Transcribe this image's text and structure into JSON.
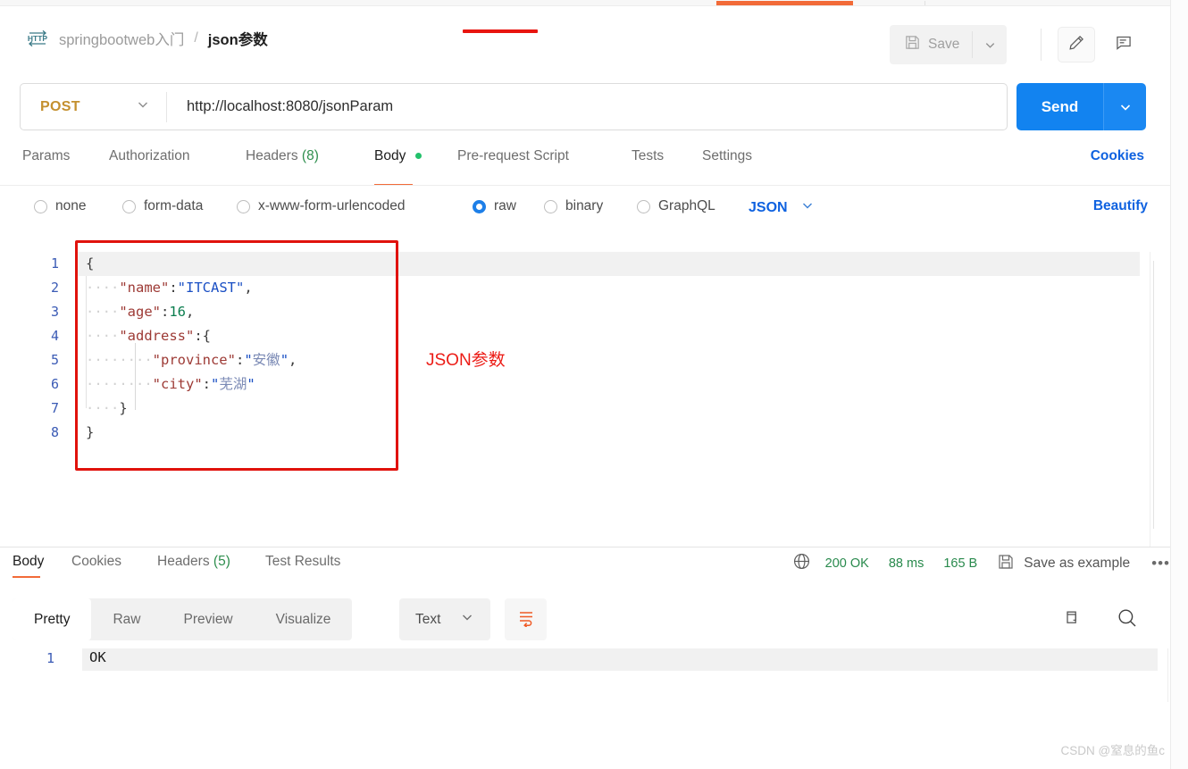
{
  "header": {
    "protocol_icon": "http-icon",
    "breadcrumb_parent": "springbootweb入门",
    "breadcrumb_separator": "/",
    "breadcrumb_current": "json参数",
    "save_label": "Save",
    "save_icon": "floppy-disk-icon",
    "save_caret_icon": "chevron-down-icon",
    "edit_icon": "pencil-icon",
    "comment_icon": "comment-icon"
  },
  "request": {
    "method": "POST",
    "method_caret_icon": "chevron-down-icon",
    "url": "http://localhost:8080/jsonParam",
    "send_label": "Send",
    "send_caret_icon": "chevron-down-icon",
    "tabs": [
      {
        "label": "Params",
        "count": "",
        "active": false
      },
      {
        "label": "Authorization",
        "count": "",
        "active": false
      },
      {
        "label": "Headers",
        "count": "(8)",
        "active": false
      },
      {
        "label": "Body",
        "count": "",
        "active": true
      },
      {
        "label": "Pre-request Script",
        "count": "",
        "active": false
      },
      {
        "label": "Tests",
        "count": "",
        "active": false
      },
      {
        "label": "Settings",
        "count": "",
        "active": false
      }
    ],
    "cookies_link": "Cookies",
    "body_types": [
      {
        "label": "none",
        "selected": false
      },
      {
        "label": "form-data",
        "selected": false
      },
      {
        "label": "x-www-form-urlencoded",
        "selected": false
      },
      {
        "label": "raw",
        "selected": true
      },
      {
        "label": "binary",
        "selected": false
      },
      {
        "label": "GraphQL",
        "selected": false
      }
    ],
    "format_label": "JSON",
    "format_caret_icon": "chevron-down-icon",
    "beautify_link": "Beautify"
  },
  "editor": {
    "line_numbers": [
      "1",
      "2",
      "3",
      "4",
      "5",
      "6",
      "7",
      "8"
    ],
    "lines": [
      {
        "indent": "",
        "tokens": [
          {
            "t": "{",
            "c": "p"
          }
        ]
      },
      {
        "indent": "····",
        "tokens": [
          {
            "t": "\"name\"",
            "c": "k"
          },
          {
            "t": ":",
            "c": "p"
          },
          {
            "t": "\"ITCAST\"",
            "c": "s"
          },
          {
            "t": ",",
            "c": "p"
          }
        ]
      },
      {
        "indent": "····",
        "tokens": [
          {
            "t": "\"age\"",
            "c": "k"
          },
          {
            "t": ":",
            "c": "p"
          },
          {
            "t": "16",
            "c": "n"
          },
          {
            "t": ",",
            "c": "p"
          }
        ]
      },
      {
        "indent": "····",
        "tokens": [
          {
            "t": "\"address\"",
            "c": "k"
          },
          {
            "t": ":",
            "c": "p"
          },
          {
            "t": "{",
            "c": "p"
          }
        ]
      },
      {
        "indent": "········",
        "tokens": [
          {
            "t": "\"province\"",
            "c": "k"
          },
          {
            "t": ":",
            "c": "p"
          },
          {
            "t": "\"",
            "c": "s"
          },
          {
            "t": "安徽",
            "c": "cjk"
          },
          {
            "t": "\"",
            "c": "s"
          },
          {
            "t": ",",
            "c": "p"
          }
        ]
      },
      {
        "indent": "········",
        "tokens": [
          {
            "t": "\"city\"",
            "c": "k"
          },
          {
            "t": ":",
            "c": "p"
          },
          {
            "t": "\"",
            "c": "s"
          },
          {
            "t": "芜湖",
            "c": "cjk"
          },
          {
            "t": "\"",
            "c": "s"
          }
        ]
      },
      {
        "indent": "····",
        "tokens": [
          {
            "t": "}",
            "c": "p"
          }
        ]
      },
      {
        "indent": "",
        "tokens": [
          {
            "t": "}",
            "c": "p"
          }
        ]
      }
    ],
    "annotation_text": "JSON参数",
    "annotation_color": "#ec1c16",
    "highlight_box_color": "#e0120c"
  },
  "response": {
    "tabs": [
      {
        "label": "Body",
        "count": "",
        "active": true
      },
      {
        "label": "Cookies",
        "count": "",
        "active": false
      },
      {
        "label": "Headers",
        "count": "(5)",
        "active": false
      },
      {
        "label": "Test Results",
        "count": "",
        "active": false
      }
    ],
    "network_icon": "globe-icon",
    "status": "200 OK",
    "time": "88 ms",
    "size": "165 B",
    "save_example_icon": "floppy-disk-icon",
    "save_example_label": "Save as example",
    "more_icon": "ellipsis-icon",
    "view_modes": [
      {
        "label": "Pretty",
        "active": true
      },
      {
        "label": "Raw",
        "active": false
      },
      {
        "label": "Preview",
        "active": false
      },
      {
        "label": "Visualize",
        "active": false
      }
    ],
    "format_label": "Text",
    "format_caret_icon": "chevron-down-icon",
    "wrap_icon": "word-wrap-icon",
    "copy_icon": "copy-icon",
    "search_icon": "search-icon",
    "body_line_number": "1",
    "body_text": "OK"
  },
  "watermark": "CSDN @窒息的鱼c",
  "colors": {
    "accent_orange": "#f26b38",
    "send_blue": "#1283f0",
    "link_blue": "#0f62e0",
    "method_amber": "#c4902f",
    "status_green": "#298a4d",
    "annotation_red": "#e0120c"
  }
}
